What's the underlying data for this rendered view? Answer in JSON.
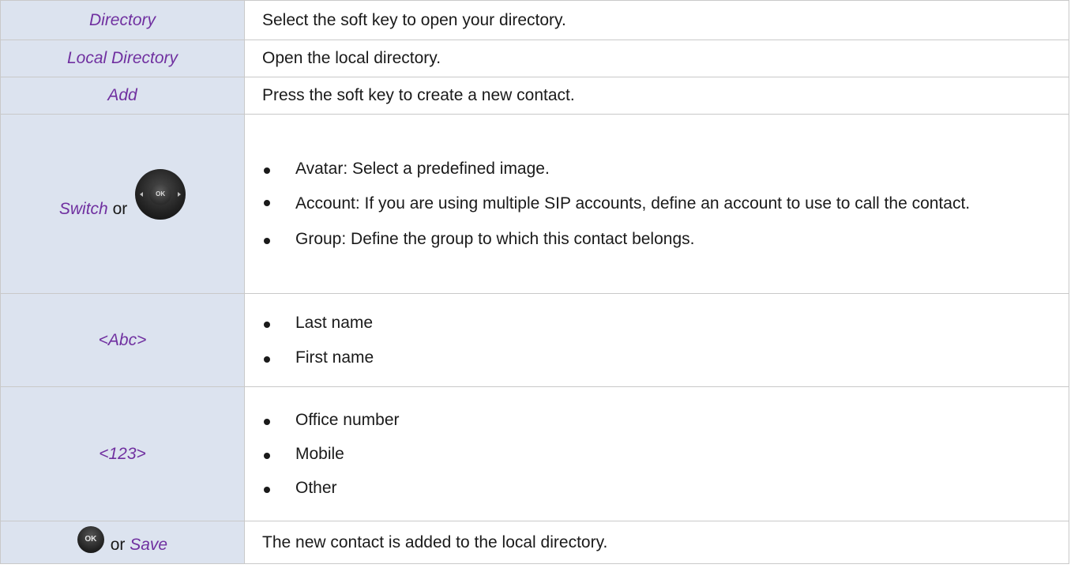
{
  "rows": [
    {
      "key": "Directory",
      "desc": "Select the soft key to open your directory."
    },
    {
      "key": "Local Directory",
      "desc": "Open the local directory."
    },
    {
      "key": "Add",
      "desc": "Press the soft key to create a new contact."
    },
    {
      "key": "Switch",
      "connector": "or",
      "icon": "navigation-pad-icon",
      "icon_label": "OK",
      "bullets": [
        "Avatar: Select a predefined image.",
        "Account: If you are using multiple SIP accounts, define an account to use to call the contact.",
        "Group: Define the group to which this contact belongs."
      ]
    },
    {
      "key": "<Abc>",
      "bullets": [
        "Last name",
        "First name"
      ]
    },
    {
      "key": "<123>",
      "bullets": [
        "Office number",
        "Mobile",
        "Other"
      ]
    },
    {
      "icon": "ok-button-icon",
      "icon_label": "OK",
      "connector": "or",
      "key": "Save",
      "desc": "The new contact is added to the local directory."
    }
  ],
  "colors": {
    "key_cell_bg": "#dce3ef",
    "key_text": "#7030a0",
    "border": "#c9c9c9"
  }
}
